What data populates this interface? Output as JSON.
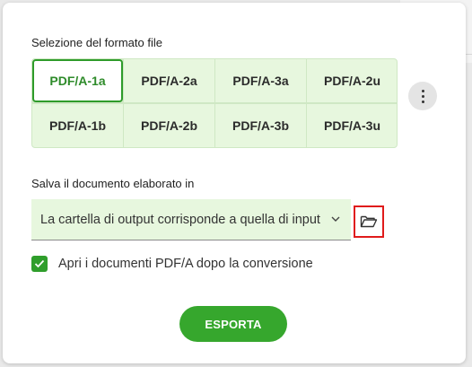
{
  "format_section": {
    "label": "Selezione del formato file",
    "formats": [
      {
        "label": "PDF/A-1a",
        "selected": true
      },
      {
        "label": "PDF/A-2a",
        "selected": false
      },
      {
        "label": "PDF/A-3a",
        "selected": false
      },
      {
        "label": "PDF/A-2u",
        "selected": false
      },
      {
        "label": "PDF/A-1b",
        "selected": false
      },
      {
        "label": "PDF/A-2b",
        "selected": false
      },
      {
        "label": "PDF/A-3b",
        "selected": false
      },
      {
        "label": "PDF/A-3u",
        "selected": false
      }
    ],
    "more_icon": "more-vertical-icon"
  },
  "save_section": {
    "label": "Salva il documento elaborato in",
    "select_value": "La cartella di output corrisponde a quella di input",
    "chevron_icon": "chevron-down-icon",
    "folder_icon": "folder-open-icon"
  },
  "open_after": {
    "checked": true,
    "label": "Apri i documenti PDF/A dopo la conversione"
  },
  "export_button": {
    "label": "ESPORTA"
  },
  "colors": {
    "accent": "#36a72d",
    "selected_text": "#2e8b2a",
    "tile_bg": "#e7f7de",
    "highlight_border": "#e01b1b"
  }
}
